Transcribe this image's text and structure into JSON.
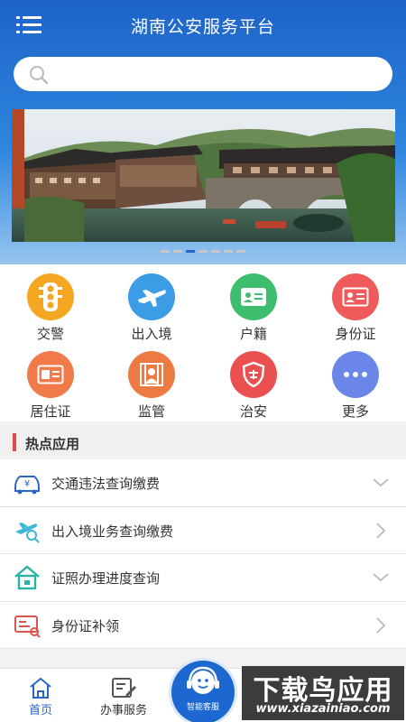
{
  "header": {
    "title": "湖南公安服务平台",
    "menu_icon": "hamburger-menu-icon"
  },
  "search": {
    "placeholder": "",
    "icon": "search-icon"
  },
  "banner": {
    "slides": 7,
    "active_slide": 3
  },
  "services": [
    {
      "label": "交警",
      "icon": "traffic-light-icon",
      "color": "#f5a623"
    },
    {
      "label": "出入境",
      "icon": "airplane-icon",
      "color": "#3d9ce6"
    },
    {
      "label": "户籍",
      "icon": "household-card-icon",
      "color": "#3fbd6e"
    },
    {
      "label": "身份证",
      "icon": "id-card-icon",
      "color": "#ef5a5a"
    },
    {
      "label": "居住证",
      "icon": "residence-card-icon",
      "color": "#f07a4a"
    },
    {
      "label": "监管",
      "icon": "supervision-bars-icon",
      "color": "#ee7a43"
    },
    {
      "label": "治安",
      "icon": "police-shield-icon",
      "color": "#ea5050"
    },
    {
      "label": "更多",
      "icon": "more-dots-icon",
      "color": "#6a86e8"
    }
  ],
  "hot_section": {
    "title": "热点应用",
    "items": [
      {
        "label": "交通违法查询缴费",
        "icon": "car-fine-icon",
        "arrow": "chevron-down-icon"
      },
      {
        "label": "出入境业务查询缴费",
        "icon": "plane-search-icon",
        "arrow": "chevron-right-icon"
      },
      {
        "label": "证照办理进度查询",
        "icon": "house-icon",
        "arrow": "chevron-down-icon"
      },
      {
        "label": "身份证补领",
        "icon": "id-reissue-icon",
        "arrow": "chevron-right-icon"
      }
    ]
  },
  "tabbar": {
    "home": "首页",
    "business": "办事服务",
    "assistant": "智能客服"
  },
  "watermark": {
    "title": "下载鸟应用",
    "url": "www.xiazainiao.com"
  },
  "colors": {
    "brand_blue": "#1e63c8",
    "accent_red": "#e24b4b"
  }
}
